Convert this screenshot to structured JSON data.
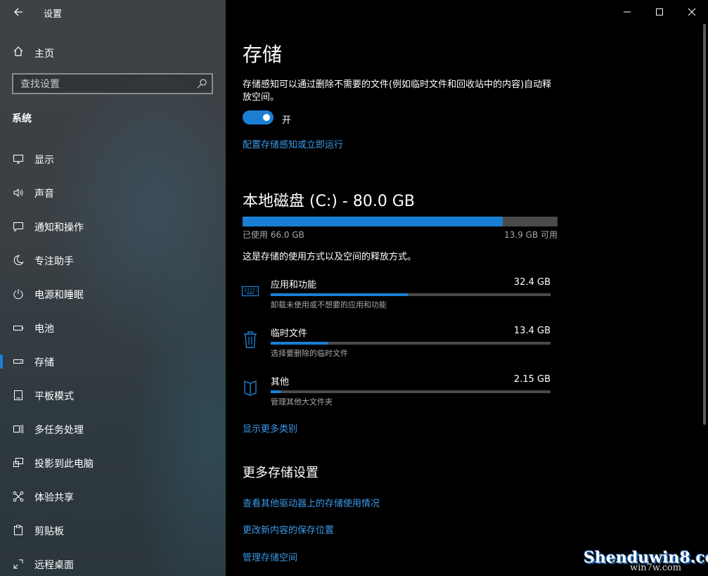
{
  "window": {
    "title": "设置"
  },
  "sidebar": {
    "home_label": "主页",
    "search_placeholder": "查找设置",
    "section_title": "系统",
    "items": [
      {
        "label": "显示",
        "icon": "display-icon"
      },
      {
        "label": "声音",
        "icon": "speaker-icon"
      },
      {
        "label": "通知和操作",
        "icon": "notification-icon"
      },
      {
        "label": "专注助手",
        "icon": "moon-icon"
      },
      {
        "label": "电源和睡眠",
        "icon": "power-icon"
      },
      {
        "label": "电池",
        "icon": "battery-icon"
      },
      {
        "label": "存储",
        "icon": "storage-icon",
        "selected": true
      },
      {
        "label": "平板模式",
        "icon": "tablet-icon"
      },
      {
        "label": "多任务处理",
        "icon": "multitask-icon"
      },
      {
        "label": "投影到此电脑",
        "icon": "project-icon"
      },
      {
        "label": "体验共享",
        "icon": "share-icon"
      },
      {
        "label": "剪贴板",
        "icon": "clipboard-icon"
      },
      {
        "label": "远程桌面",
        "icon": "remote-desktop-icon"
      }
    ]
  },
  "main": {
    "title": "存储",
    "storage_sense_desc": "存储感知可以通过删除不需要的文件(例如临时文件和回收站中的内容)自动释放空间。",
    "toggle_state": "开",
    "configure_link": "配置存储感知或立即运行",
    "disk": {
      "title": "本地磁盘 (C:) - 80.0 GB",
      "used_label": "已使用 66.0 GB",
      "free_label": "13.9 GB 可用",
      "used_fraction": 0.826
    },
    "usage_desc": "这是存储的使用方式以及空间的释放方式。",
    "categories": [
      {
        "name": "应用和功能",
        "size": "32.4 GB",
        "sub": "卸载未使用或不想要的应用和功能",
        "fraction": 0.49,
        "icon": "keyboard-icon"
      },
      {
        "name": "临时文件",
        "size": "13.4 GB",
        "sub": "选择要删除的临时文件",
        "fraction": 0.205,
        "icon": "trash-icon"
      },
      {
        "name": "其他",
        "size": "2.15 GB",
        "sub": "管理其他大文件夹",
        "fraction": 0.035,
        "icon": "other-files-icon"
      }
    ],
    "show_more_link": "显示更多类别",
    "more_settings_title": "更多存储设置",
    "more_links": [
      "查看其他驱动器上的存储使用情况",
      "更改新内容的保存位置",
      "管理存储空间"
    ]
  },
  "watermark": {
    "line1": "Shenduwin8.com",
    "line2": "win7w.com"
  },
  "colors": {
    "accent": "#1a7fd4",
    "link": "#3b9ae8",
    "bg": "#000000"
  }
}
